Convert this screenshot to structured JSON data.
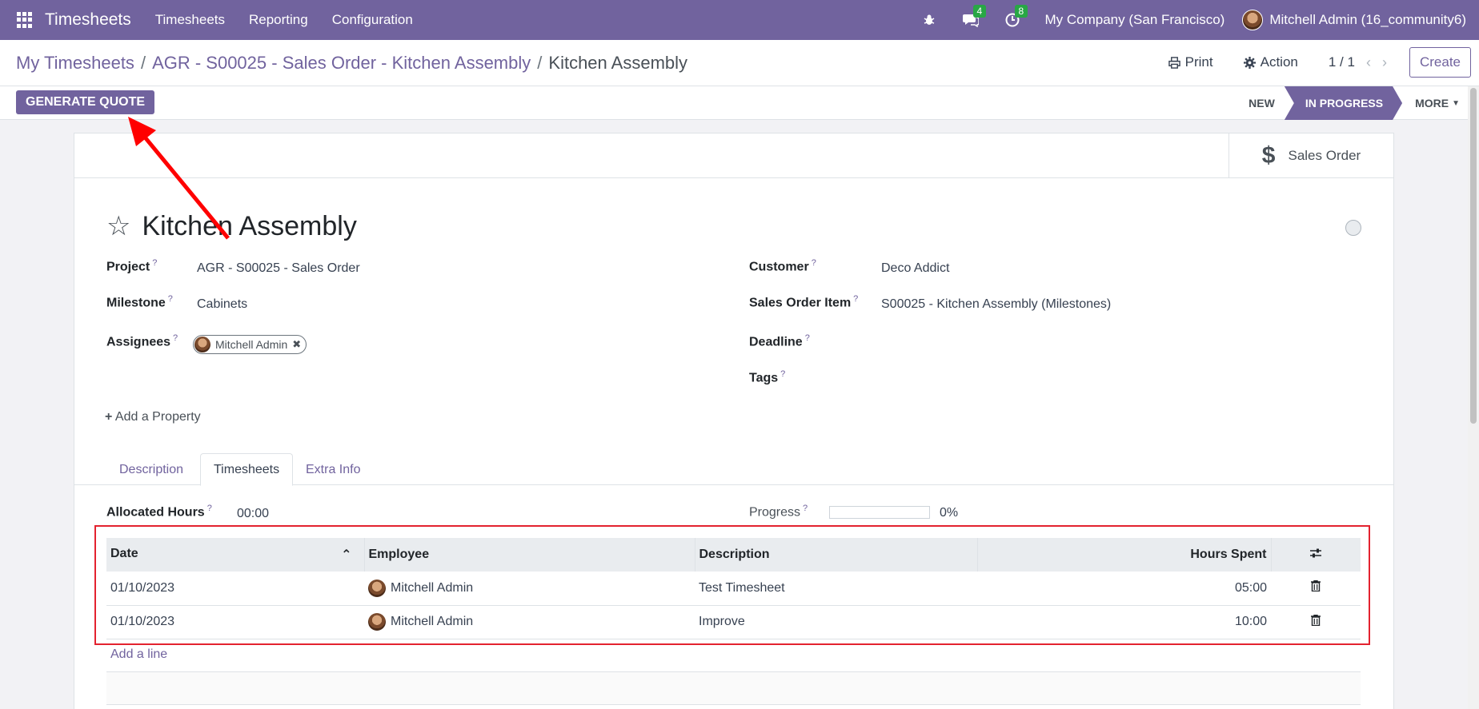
{
  "navbar": {
    "brand": "Timesheets",
    "menu": [
      "Timesheets",
      "Reporting",
      "Configuration"
    ],
    "messages_count": "4",
    "activities_count": "8",
    "company": "My Company (San Francisco)",
    "user": "Mitchell Admin (16_community6)",
    "accent_color": "#71639e"
  },
  "control": {
    "breadcrumb": [
      "My Timesheets",
      "AGR - S00025 - Sales Order - Kitchen Assembly",
      "Kitchen Assembly"
    ],
    "print": "Print",
    "action": "Action",
    "pager": "1 / 1",
    "create": "Create"
  },
  "statusbar": {
    "generate_quote": "GENERATE QUOTE",
    "stages": [
      "NEW",
      "IN PROGRESS",
      "MORE"
    ],
    "active_stage": "IN PROGRESS"
  },
  "smart_button": {
    "label": "Sales Order",
    "icon": "dollar-icon"
  },
  "task": {
    "title": "Kitchen Assembly",
    "fields_left": [
      {
        "label": "Project",
        "value": "AGR - S00025 - Sales Order"
      },
      {
        "label": "Milestone",
        "value": "Cabinets"
      },
      {
        "label": "Assignees",
        "value": "Mitchell Admin"
      }
    ],
    "fields_right": [
      {
        "label": "Customer",
        "value": "Deco Addict"
      },
      {
        "label": "Sales Order Item",
        "value": "S00025 - Kitchen Assembly (Milestones)"
      },
      {
        "label": "Deadline",
        "value": ""
      },
      {
        "label": "Tags",
        "value": ""
      }
    ],
    "add_property": "Add a Property"
  },
  "tabs": [
    "Description",
    "Timesheets",
    "Extra Info"
  ],
  "active_tab": "Timesheets",
  "timesheets": {
    "allocated_label": "Allocated Hours",
    "allocated_value": "00:00",
    "progress_label": "Progress",
    "progress_value": "0%",
    "progress_fraction": 0,
    "columns": [
      "Date",
      "Employee",
      "Description",
      "Hours Spent"
    ],
    "rows": [
      {
        "date": "01/10/2023",
        "employee": "Mitchell Admin",
        "description": "Test Timesheet",
        "hours": "05:00"
      },
      {
        "date": "01/10/2023",
        "employee": "Mitchell Admin",
        "description": "Improve",
        "hours": "10:00"
      }
    ],
    "add_line": "Add a line"
  }
}
